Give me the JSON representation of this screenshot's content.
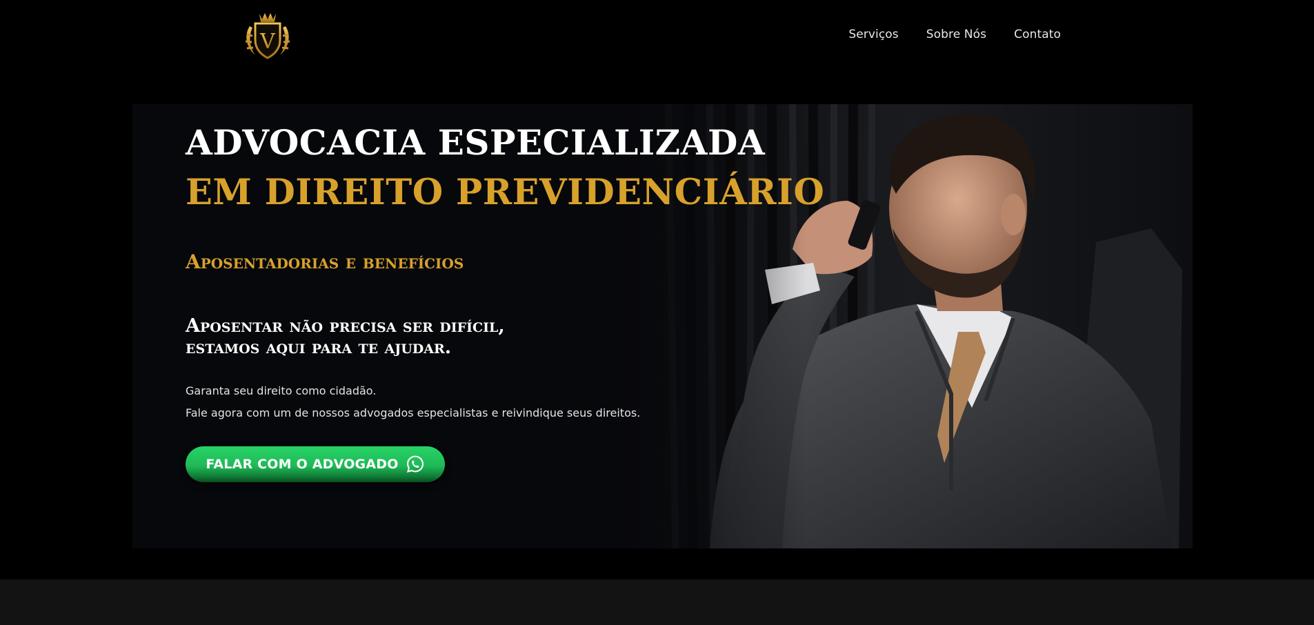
{
  "nav": {
    "items": [
      {
        "label": "Serviços"
      },
      {
        "label": "Sobre Nós"
      },
      {
        "label": "Contato"
      }
    ]
  },
  "logo": {
    "letter": "V",
    "icon": "crown-shield-logo"
  },
  "hero": {
    "title_line1": "ADVOCACIA ESPECIALIZADA",
    "title_line2": "EM DIREITO PREVIDENCIÁRIO",
    "subtitle": "Aposentadorias e benefícios",
    "tagline_line1": "Aposentar não precisa ser difícil,",
    "tagline_line2": "estamos aqui para te ajudar.",
    "paragraph1": "Garanta seu direito como cidadão.",
    "paragraph2": "Fale agora com um de nossos advogados especialistas e reivindique seus direitos.",
    "cta_label": "FALAR COM O ADVOGADO",
    "cta_icon": "whatsapp-icon"
  },
  "colors": {
    "gold": "#d8a12c",
    "background": "#000000",
    "cta_green": "#25d366"
  }
}
